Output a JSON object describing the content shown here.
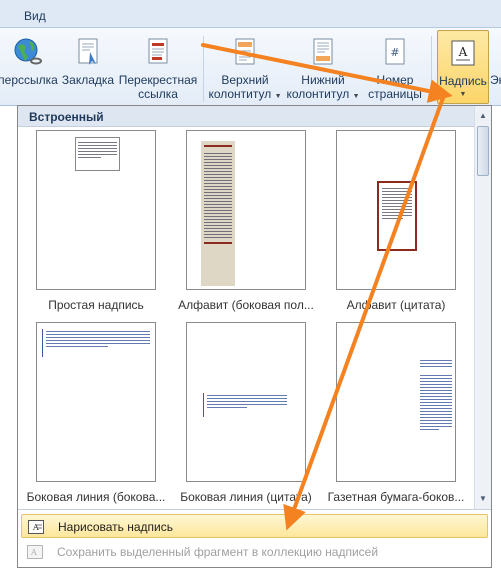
{
  "ribbon": {
    "tab_view": "Вид",
    "buttons": {
      "hyperlink": "перссылка",
      "bookmark": "Закладка",
      "cross_ref_1": "Перекрестная",
      "cross_ref_2": "ссылка",
      "header_1": "Верхний",
      "header_2": "колонтитул",
      "footer_1": "Нижний",
      "footer_2": "колонтитул",
      "page_num_1": "Номер",
      "page_num_2": "страницы",
      "textbox": "Надпись",
      "partial": "Эк"
    }
  },
  "gallery": {
    "section_title": "Встроенный",
    "items": [
      {
        "caption": "Простая надпись"
      },
      {
        "caption": "Алфавит (боковая пол..."
      },
      {
        "caption": "Алфавит (цитата)"
      },
      {
        "caption": "Боковая линия (бокова..."
      },
      {
        "caption": "Боковая линия (цитата)"
      },
      {
        "caption": "Газетная бумага-боков..."
      }
    ]
  },
  "menu": {
    "draw_textbox": "Нарисовать надпись",
    "save_selection": "Сохранить выделенный фрагмент в коллекцию надписей"
  },
  "colors": {
    "accent_orange": "#f58220",
    "active_button": "#fcd569",
    "ribbon_bg": "#e3ecf7"
  }
}
